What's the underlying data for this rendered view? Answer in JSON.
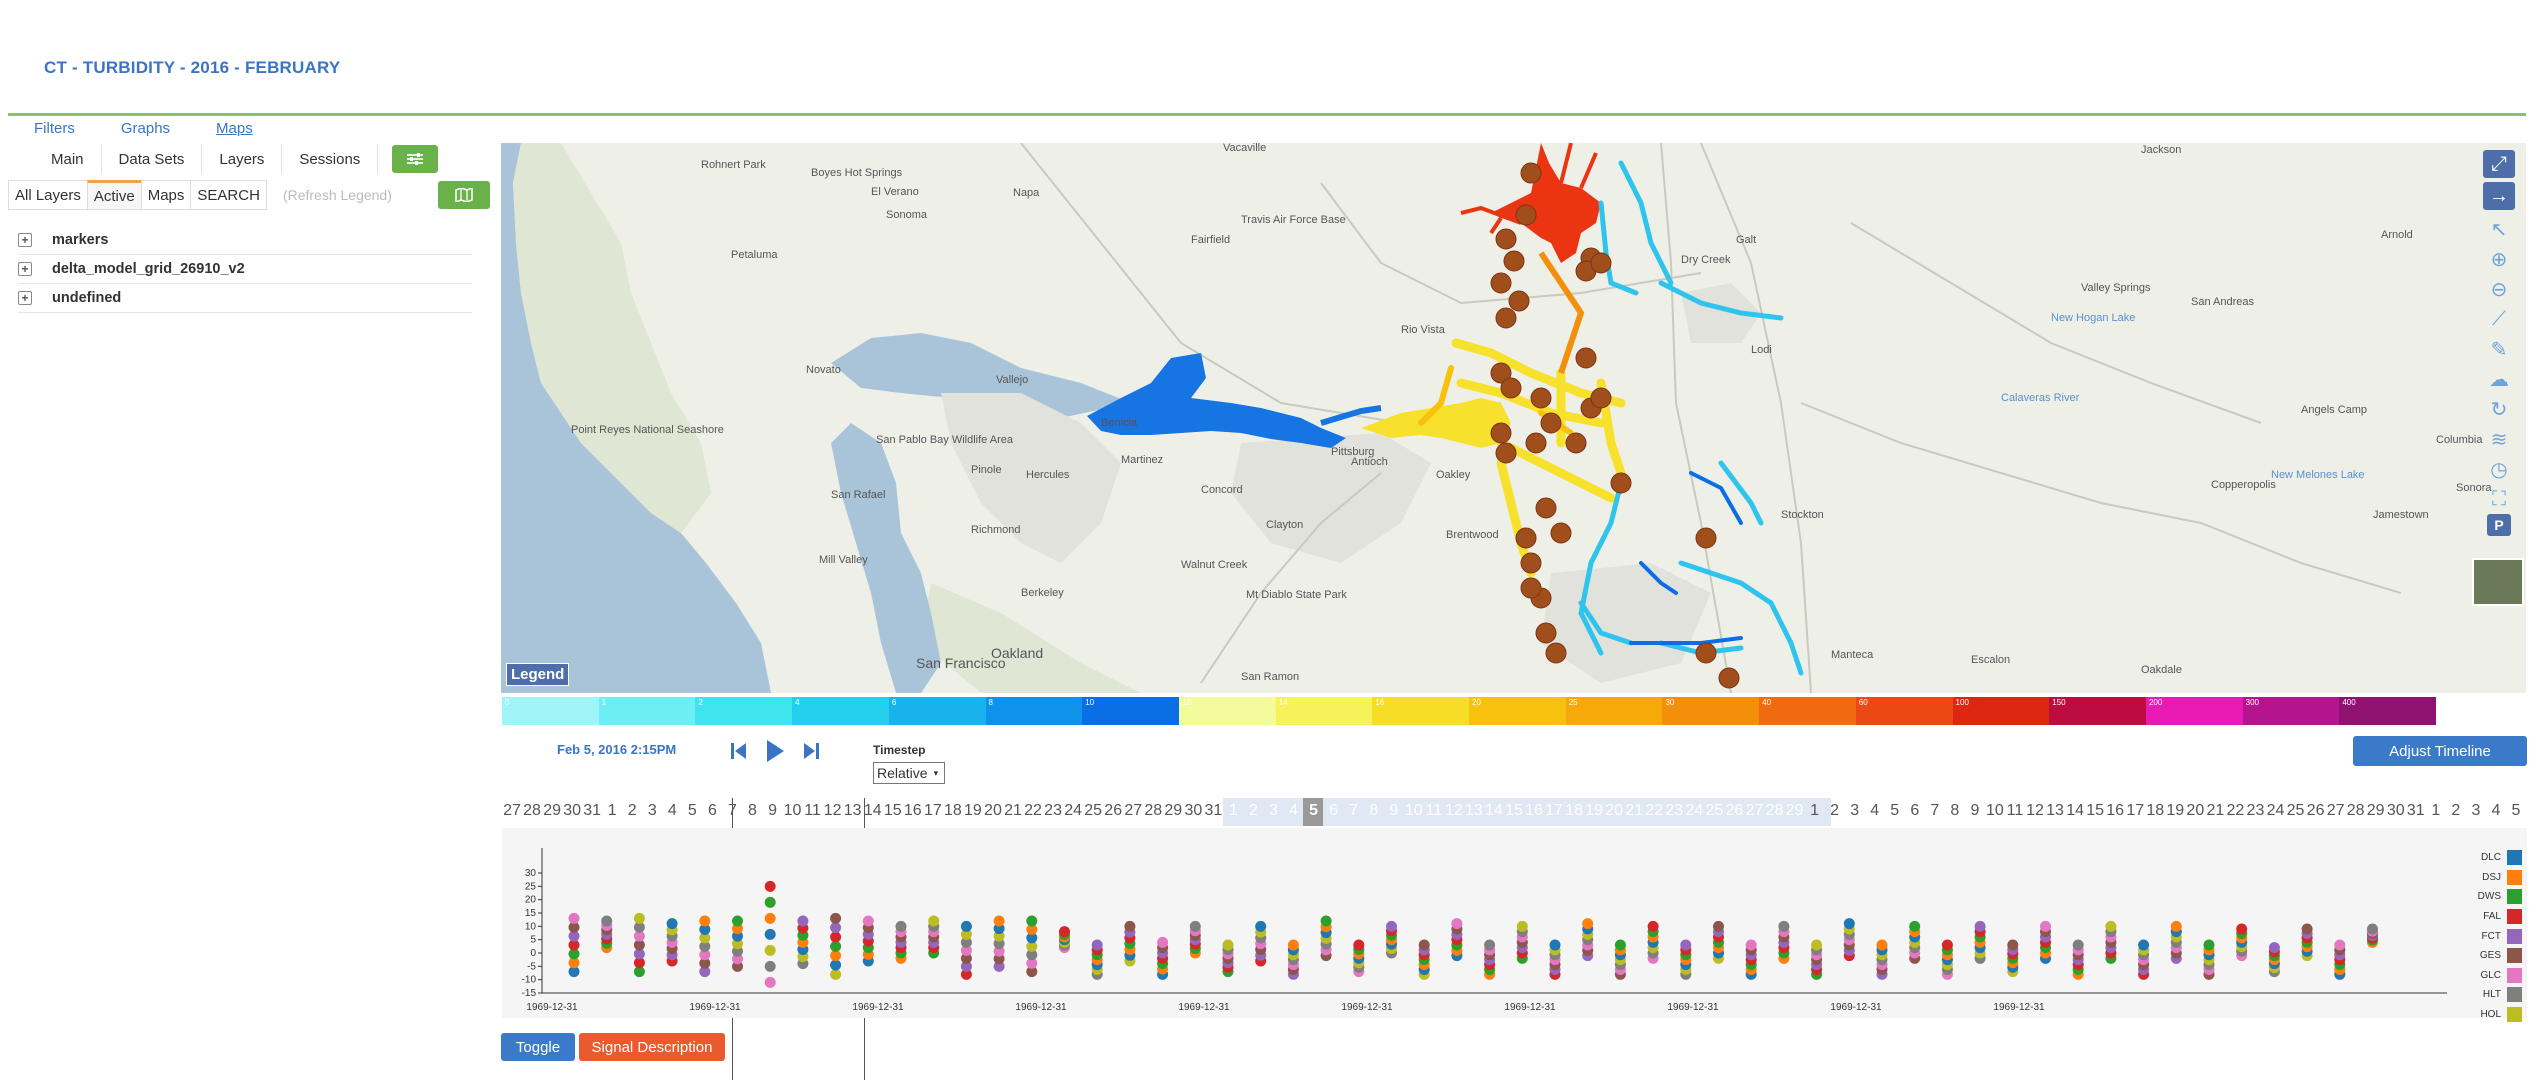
{
  "page_title": "CT - TURBIDITY - 2016 - FEBRUARY",
  "top_links": [
    "Filters",
    "Graphs",
    "Maps"
  ],
  "main_tabs": [
    "Main",
    "Data Sets",
    "Layers",
    "Sessions"
  ],
  "layer_tabs": [
    "All Layers",
    "Active",
    "Maps",
    "SEARCH"
  ],
  "refresh_legend": "(Refresh Legend)",
  "layers": [
    "markers",
    "delta_model_grid_26910_v2",
    "undefined"
  ],
  "map_legend_label": "Legend",
  "map_labels": [
    {
      "text": "Vacaville"
    },
    {
      "text": "Rohnert Park"
    },
    {
      "text": "Boyes Hot Springs"
    },
    {
      "text": "El Verano"
    },
    {
      "text": "Sonoma"
    },
    {
      "text": "Napa"
    },
    {
      "text": "Fairfield"
    },
    {
      "text": "Travis Air Force Base"
    },
    {
      "text": "Petaluma"
    },
    {
      "text": "Rio Vista"
    },
    {
      "text": "Novato"
    },
    {
      "text": "Vallejo"
    },
    {
      "text": "Point Reyes National Seashore"
    },
    {
      "text": "San Pablo Bay Wildlife Area"
    },
    {
      "text": "Benicia"
    },
    {
      "text": "Martinez"
    },
    {
      "text": "Pittsburg"
    },
    {
      "text": "Antioch"
    },
    {
      "text": "Oakley"
    },
    {
      "text": "Concord"
    },
    {
      "text": "Pinole"
    },
    {
      "text": "Hercules"
    },
    {
      "text": "San Rafael"
    },
    {
      "text": "Richmond"
    },
    {
      "text": "Mill Valley"
    },
    {
      "text": "Clayton"
    },
    {
      "text": "Brentwood"
    },
    {
      "text": "Walnut Creek"
    },
    {
      "text": "Mt Diablo State Park"
    },
    {
      "text": "Berkeley"
    },
    {
      "text": "Oakland"
    },
    {
      "text": "San Francisco"
    },
    {
      "text": "San Ramon"
    },
    {
      "text": "Lodi"
    },
    {
      "text": "Galt"
    },
    {
      "text": "Dry Creek"
    },
    {
      "text": "Jackson"
    },
    {
      "text": "Valley Springs"
    },
    {
      "text": "San Andreas"
    },
    {
      "text": "Arnold"
    },
    {
      "text": "Angels Camp"
    },
    {
      "text": "Columbia"
    },
    {
      "text": "Copperopolis"
    },
    {
      "text": "Sonora"
    },
    {
      "text": "Jamestown"
    },
    {
      "text": "Stockton"
    },
    {
      "text": "Manteca"
    },
    {
      "text": "Escalon"
    },
    {
      "text": "Oakdale"
    },
    {
      "text": "New Hogan Lake"
    },
    {
      "text": "New Melones Lake"
    },
    {
      "text": "Calaveras River"
    }
  ],
  "color_scale": [
    {
      "label": "0",
      "color": "#9ff4f7"
    },
    {
      "label": "1",
      "color": "#6deef4"
    },
    {
      "label": "2",
      "color": "#3fe4ef"
    },
    {
      "label": "4",
      "color": "#23cfec"
    },
    {
      "label": "6",
      "color": "#18b3ec"
    },
    {
      "label": "8",
      "color": "#0f92ea"
    },
    {
      "label": "10",
      "color": "#0a6fe6"
    },
    {
      "label": "12",
      "color": "#f3fb9d"
    },
    {
      "label": "14",
      "color": "#f6f35a"
    },
    {
      "label": "16",
      "color": "#f7de26"
    },
    {
      "label": "20",
      "color": "#f7c10d"
    },
    {
      "label": "25",
      "color": "#f7a90a"
    },
    {
      "label": "30",
      "color": "#f48f0c"
    },
    {
      "label": "40",
      "color": "#f06b0f"
    },
    {
      "label": "60",
      "color": "#ec4815"
    },
    {
      "label": "100",
      "color": "#de2712"
    },
    {
      "label": "150",
      "color": "#bd0c3e"
    },
    {
      "label": "200",
      "color": "#e91ab4"
    },
    {
      "label": "300",
      "color": "#b4148e"
    },
    {
      "label": "400",
      "color": "#8f1270"
    }
  ],
  "timeline": {
    "current_date": "Feb 5, 2016 2:15PM",
    "timestep_label": "Timestep",
    "timestep_value": "Relative",
    "adjust_label": "Adjust Timeline",
    "days": [
      "27",
      "28",
      "29",
      "30",
      "31",
      "1",
      "2",
      "3",
      "4",
      "5",
      "6",
      "7",
      "8",
      "9",
      "10",
      "11",
      "12",
      "13",
      "14",
      "15",
      "16",
      "17",
      "18",
      "19",
      "20",
      "21",
      "22",
      "23",
      "24",
      "25",
      "26",
      "27",
      "28",
      "29",
      "30",
      "31",
      "1",
      "2",
      "3",
      "4",
      "5",
      "6",
      "7",
      "8",
      "9",
      "10",
      "11",
      "12",
      "13",
      "14",
      "15",
      "16",
      "17",
      "18",
      "19",
      "20",
      "21",
      "22",
      "23",
      "24",
      "25",
      "26",
      "27",
      "28",
      "29",
      "1",
      "2",
      "3",
      "4",
      "5",
      "6",
      "7",
      "8",
      "9",
      "10",
      "11",
      "12",
      "13",
      "14",
      "15",
      "16",
      "17",
      "18",
      "19",
      "20",
      "21",
      "22",
      "23",
      "24",
      "25",
      "26",
      "27",
      "28",
      "29",
      "30",
      "31",
      "1",
      "2",
      "3",
      "4",
      "5"
    ],
    "selected_day": "5"
  },
  "chart_data": {
    "type": "scatter",
    "y_ticks": [
      30,
      25,
      20,
      15,
      10,
      5,
      0,
      -5,
      -10,
      -15
    ],
    "ylim": [
      -15,
      30
    ],
    "x_tick_label": "1969-12-31",
    "x_tick_count": 10,
    "series": [
      {
        "name": "DLC",
        "color": "#1f77b4"
      },
      {
        "name": "DSJ",
        "color": "#ff7f0e"
      },
      {
        "name": "DWS",
        "color": "#2ca02c"
      },
      {
        "name": "FAL",
        "color": "#d62728"
      },
      {
        "name": "FCT",
        "color": "#9467bd"
      },
      {
        "name": "GES",
        "color": "#8c564b"
      },
      {
        "name": "GLC",
        "color": "#e377c2"
      },
      {
        "name": "HLT",
        "color": "#7f7f7f"
      },
      {
        "name": "HOL",
        "color": "#bcbd22"
      }
    ],
    "columns": [
      {
        "x": 0,
        "min": -7,
        "max": 13
      },
      {
        "x": 1,
        "min": 2,
        "max": 12
      },
      {
        "x": 2,
        "min": -7,
        "max": 13
      },
      {
        "x": 3,
        "min": -3,
        "max": 11
      },
      {
        "x": 4,
        "min": -7,
        "max": 12
      },
      {
        "x": 5,
        "min": -5,
        "max": 12
      },
      {
        "x": 6,
        "min": -11,
        "max": 25
      },
      {
        "x": 7,
        "min": -4,
        "max": 12
      },
      {
        "x": 8,
        "min": -8,
        "max": 13
      },
      {
        "x": 9,
        "min": -3,
        "max": 12
      },
      {
        "x": 10,
        "min": -2,
        "max": 10
      },
      {
        "x": 11,
        "min": 0,
        "max": 12
      },
      {
        "x": 12,
        "min": -8,
        "max": 10
      },
      {
        "x": 13,
        "min": -5,
        "max": 12
      },
      {
        "x": 14,
        "min": -7,
        "max": 12
      },
      {
        "x": 15,
        "min": 2,
        "max": 8
      },
      {
        "x": 16,
        "min": -8,
        "max": 3
      },
      {
        "x": 17,
        "min": -3,
        "max": 10
      },
      {
        "x": 18,
        "min": -8,
        "max": 4
      },
      {
        "x": 19,
        "min": 0,
        "max": 10
      },
      {
        "x": 20,
        "min": -7,
        "max": 3
      },
      {
        "x": 21,
        "min": -3,
        "max": 10
      },
      {
        "x": 22,
        "min": -8,
        "max": 3
      },
      {
        "x": 23,
        "min": -1,
        "max": 12
      },
      {
        "x": 24,
        "min": -7,
        "max": 3
      },
      {
        "x": 25,
        "min": 0,
        "max": 10
      },
      {
        "x": 26,
        "min": -8,
        "max": 3
      },
      {
        "x": 27,
        "min": -1,
        "max": 11
      },
      {
        "x": 28,
        "min": -8,
        "max": 3
      },
      {
        "x": 29,
        "min": -2,
        "max": 10
      },
      {
        "x": 30,
        "min": -8,
        "max": 3
      },
      {
        "x": 31,
        "min": -1,
        "max": 11
      },
      {
        "x": 32,
        "min": -8,
        "max": 3
      },
      {
        "x": 33,
        "min": -2,
        "max": 10
      },
      {
        "x": 34,
        "min": -8,
        "max": 3
      },
      {
        "x": 35,
        "min": -2,
        "max": 10
      },
      {
        "x": 36,
        "min": -8,
        "max": 3
      },
      {
        "x": 37,
        "min": -2,
        "max": 10
      },
      {
        "x": 38,
        "min": -8,
        "max": 3
      },
      {
        "x": 39,
        "min": -1,
        "max": 11
      },
      {
        "x": 40,
        "min": -8,
        "max": 3
      },
      {
        "x": 41,
        "min": -2,
        "max": 10
      },
      {
        "x": 42,
        "min": -8,
        "max": 3
      },
      {
        "x": 43,
        "min": -2,
        "max": 10
      },
      {
        "x": 44,
        "min": -7,
        "max": 3
      },
      {
        "x": 45,
        "min": -2,
        "max": 10
      },
      {
        "x": 46,
        "min": -8,
        "max": 3
      },
      {
        "x": 47,
        "min": -2,
        "max": 10
      },
      {
        "x": 48,
        "min": -8,
        "max": 3
      },
      {
        "x": 49,
        "min": -2,
        "max": 10
      },
      {
        "x": 50,
        "min": -8,
        "max": 3
      },
      {
        "x": 51,
        "min": -1,
        "max": 9
      },
      {
        "x": 52,
        "min": -7,
        "max": 2
      },
      {
        "x": 53,
        "min": -1,
        "max": 9
      },
      {
        "x": 54,
        "min": -8,
        "max": 3
      },
      {
        "x": 55,
        "min": 4,
        "max": 9
      }
    ]
  },
  "buttons": {
    "toggle": "Toggle",
    "signal": "Signal Description"
  }
}
